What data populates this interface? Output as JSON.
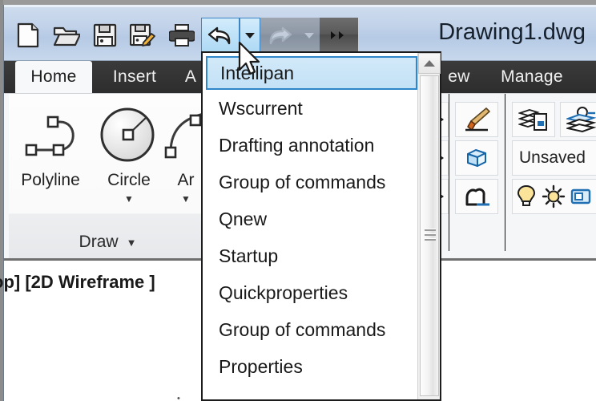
{
  "window": {
    "title": "Drawing1.dwg"
  },
  "quick_access_toolbar": {
    "buttons": [
      {
        "name": "qnew-button",
        "icon": "new-document-icon",
        "state": "normal"
      },
      {
        "name": "open-button",
        "icon": "open-folder-icon",
        "state": "normal"
      },
      {
        "name": "save-button",
        "icon": "floppy-save-icon",
        "state": "normal"
      },
      {
        "name": "saveas-button",
        "icon": "floppy-saveas-icon",
        "state": "normal"
      },
      {
        "name": "plot-button",
        "icon": "printer-icon",
        "state": "normal"
      },
      {
        "name": "undo-button",
        "icon": "undo-arrow-icon",
        "state": "selected"
      },
      {
        "name": "undo-dropdown-button",
        "icon": "chevron-down-icon",
        "state": "selected"
      },
      {
        "name": "redo-button",
        "icon": "redo-arrow-icon",
        "state": "disabled"
      },
      {
        "name": "redo-dropdown-button",
        "icon": "chevron-down-icon",
        "state": "disabled"
      },
      {
        "name": "more-commands-button",
        "icon": "double-chevron-right-icon",
        "state": "normal"
      }
    ]
  },
  "ribbon": {
    "tabs": [
      {
        "label": "Home",
        "active": true
      },
      {
        "label": "Insert",
        "active": false
      },
      {
        "label": "A",
        "active": false
      },
      {
        "label": "ew",
        "active": false
      },
      {
        "label": "Manage",
        "active": false
      }
    ],
    "draw_panel": {
      "title": "Draw",
      "caret": "▼",
      "buttons": [
        {
          "label": "Polyline",
          "icon": "polyline-icon",
          "has_caret": false
        },
        {
          "label": "Circle",
          "icon": "circle-icon",
          "has_caret": true,
          "caret": "▼"
        },
        {
          "label": "Ar",
          "icon": "arc-icon",
          "has_caret": true,
          "caret": "▼"
        }
      ]
    },
    "properties_panel": {
      "buttons": [
        {
          "name": "match-properties-button",
          "icon": "paintbrush-icon"
        },
        {
          "name": "isometric-view-button",
          "icon": "isometric-cube-icon"
        },
        {
          "name": "revision-cloud-button",
          "icon": "revision-cloud-icon"
        }
      ]
    },
    "layers_panel": {
      "buttons": [
        {
          "name": "layer-properties-button",
          "icon": "layer-properties-icon"
        },
        {
          "name": "layer-state-button",
          "icon": "layer-stack-icon"
        },
        {
          "name": "layer-on-button",
          "icon": "lightbulb-icon"
        },
        {
          "name": "layer-freeze-button",
          "icon": "sun-icon"
        },
        {
          "name": "layer-lock-button",
          "icon": "lock-plate-icon"
        }
      ],
      "layer_state_value": "Unsaved"
    }
  },
  "drawing_area": {
    "viewport_label": "op] [2D Wireframe ]"
  },
  "dropdown": {
    "name": "undo-history-dropdown",
    "items": [
      {
        "label": "Intellipan",
        "selected": true
      },
      {
        "label": "Wscurrent",
        "selected": false
      },
      {
        "label": "Drafting  annotation",
        "selected": false
      },
      {
        "label": "Group of commands",
        "selected": false
      },
      {
        "label": "Qnew",
        "selected": false
      },
      {
        "label": "Startup",
        "selected": false
      },
      {
        "label": "Quickproperties",
        "selected": false
      },
      {
        "label": "Group of commands",
        "selected": false
      },
      {
        "label": "Properties",
        "selected": false
      }
    ],
    "scrollbar": {
      "up_arrow": "▲"
    }
  },
  "colors": {
    "accent_selection": "#2f86c8",
    "selection_fill": "#c3e1f6",
    "titlebar": "#bfd2e8",
    "tabbar": "#343434",
    "ribbon_bg": "#f5f6f7",
    "layer_text": "#222222"
  }
}
